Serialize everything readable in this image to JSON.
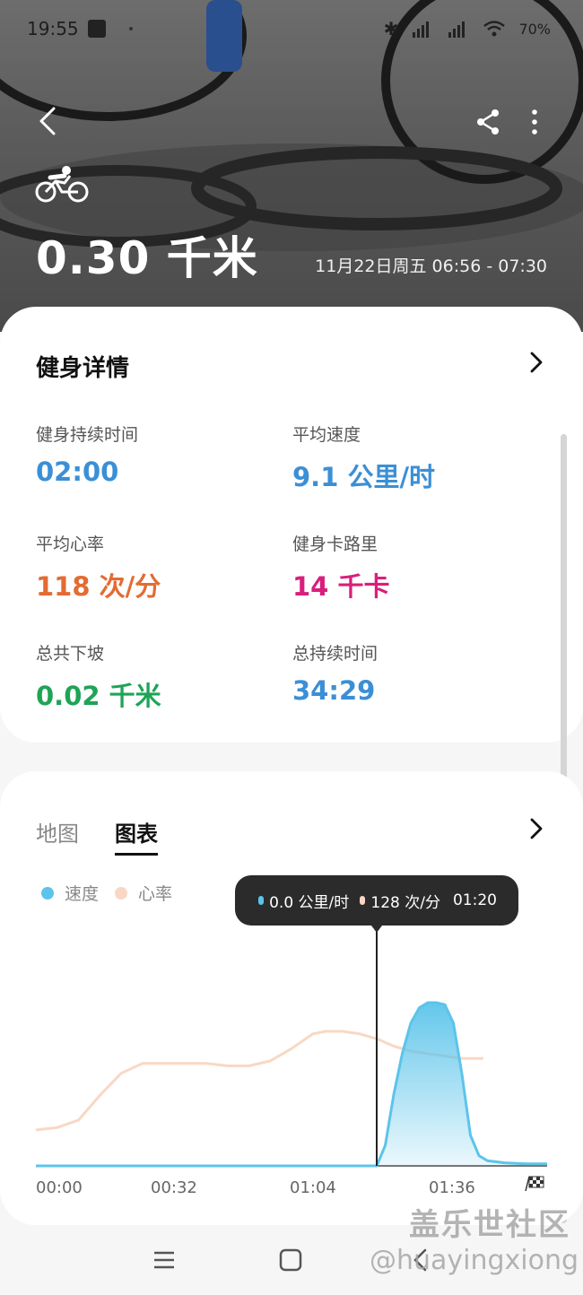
{
  "status_bar": {
    "time": "19:55",
    "battery": "70"
  },
  "header": {
    "distance": "0.30 千米",
    "date_range": "11月22日周五 06:56 - 07:30"
  },
  "details": {
    "title": "健身详情",
    "stats": [
      {
        "label": "健身持续时间",
        "value": "02:00",
        "color": "#3b8fd6"
      },
      {
        "label": "平均速度",
        "value": "9.1 公里/时",
        "color": "#3b8fd6"
      },
      {
        "label": "平均心率",
        "value": "118 次/分",
        "color": "#e26c32"
      },
      {
        "label": "健身卡路里",
        "value": "14 千卡",
        "color": "#d81f7c"
      },
      {
        "label": "总共下坡",
        "value": "0.02 千米",
        "color": "#1fa456"
      },
      {
        "label": "总持续时间",
        "value": "34:29",
        "color": "#3b8fd6"
      }
    ]
  },
  "chart_section": {
    "tabs": [
      "地图",
      "图表"
    ],
    "active_tab": "图表",
    "legend": [
      {
        "name": "速度",
        "color": "#5cc4ea"
      },
      {
        "name": "心率",
        "color": "#f8d8c4"
      }
    ],
    "tooltip": {
      "speed": "0.0 公里/时",
      "heart_rate": "128 次/分",
      "time": "01:20"
    }
  },
  "chart_data": {
    "type": "area",
    "x_ticks": [
      "00:00",
      "00:32",
      "01:04",
      "01:36"
    ],
    "series": [
      {
        "name": "速度",
        "unit": "公里/时",
        "x": [
          0,
          10,
          20,
          30,
          40,
          50,
          60,
          70,
          78,
          80,
          82,
          84,
          86,
          88,
          90,
          92,
          94,
          96,
          98,
          100,
          102,
          104,
          106,
          110,
          115,
          120
        ],
        "values": [
          0,
          0,
          0,
          0,
          0,
          0,
          0,
          0,
          0,
          0,
          2,
          7,
          11,
          14,
          15.5,
          16,
          16,
          15.8,
          14,
          9,
          3,
          1,
          0.5,
          0.3,
          0.2,
          0.2
        ]
      },
      {
        "name": "心率",
        "unit": "次/分",
        "x": [
          0,
          5,
          10,
          15,
          20,
          25,
          30,
          35,
          40,
          45,
          50,
          55,
          60,
          65,
          68,
          72,
          76,
          80,
          84,
          88,
          92,
          96,
          100,
          105
        ],
        "values": [
          91,
          92,
          95,
          105,
          114,
          118,
          118,
          118,
          118,
          117,
          117,
          119,
          124,
          130,
          131,
          131,
          130,
          128,
          125,
          123,
          122,
          121,
          120,
          120
        ]
      }
    ],
    "cursor_x": 80,
    "xlim": [
      0,
      120
    ]
  },
  "watermark": {
    "line1": "盖乐世社区",
    "line2": "@huayingxiong"
  }
}
